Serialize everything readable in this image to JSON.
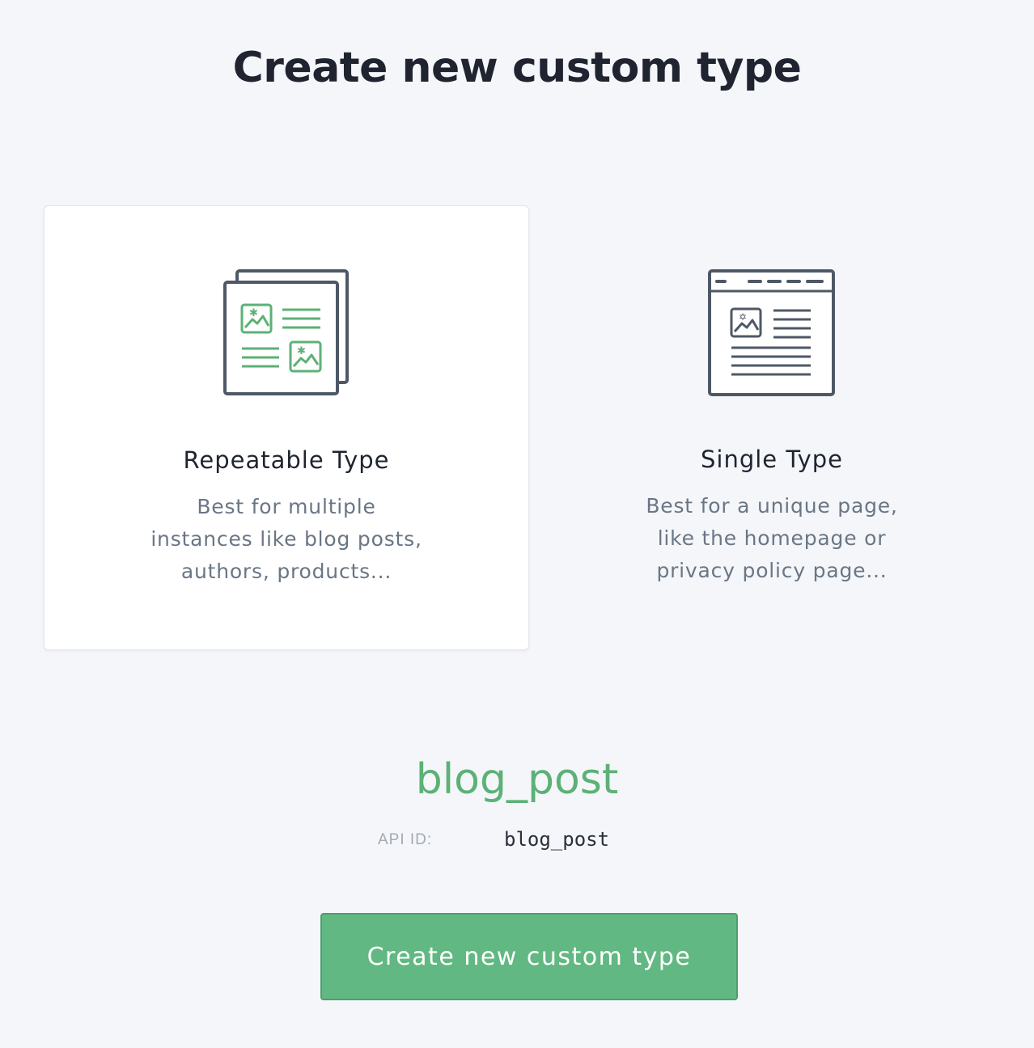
{
  "page": {
    "title": "Create new custom type"
  },
  "types": [
    {
      "title": "Repeatable Type",
      "description_lines": [
        "Best for multiple",
        "instances like blog posts,",
        "authors, products..."
      ],
      "icon": "repeatable-documents-icon",
      "selected": true
    },
    {
      "title": "Single Type",
      "description_lines": [
        "Best for a unique page,",
        "like the homepage or",
        "privacy policy page..."
      ],
      "icon": "single-page-icon",
      "selected": false
    }
  ],
  "form": {
    "type_name": "blog_post",
    "api_id_label": "API ID:",
    "api_id_value": "blog_post"
  },
  "submit_label": "Create new custom type",
  "colors": {
    "accent": "#62b882",
    "accent_text": "#5cb176",
    "icon_stroke": "#4e5866",
    "background": "#f4f6fa"
  }
}
